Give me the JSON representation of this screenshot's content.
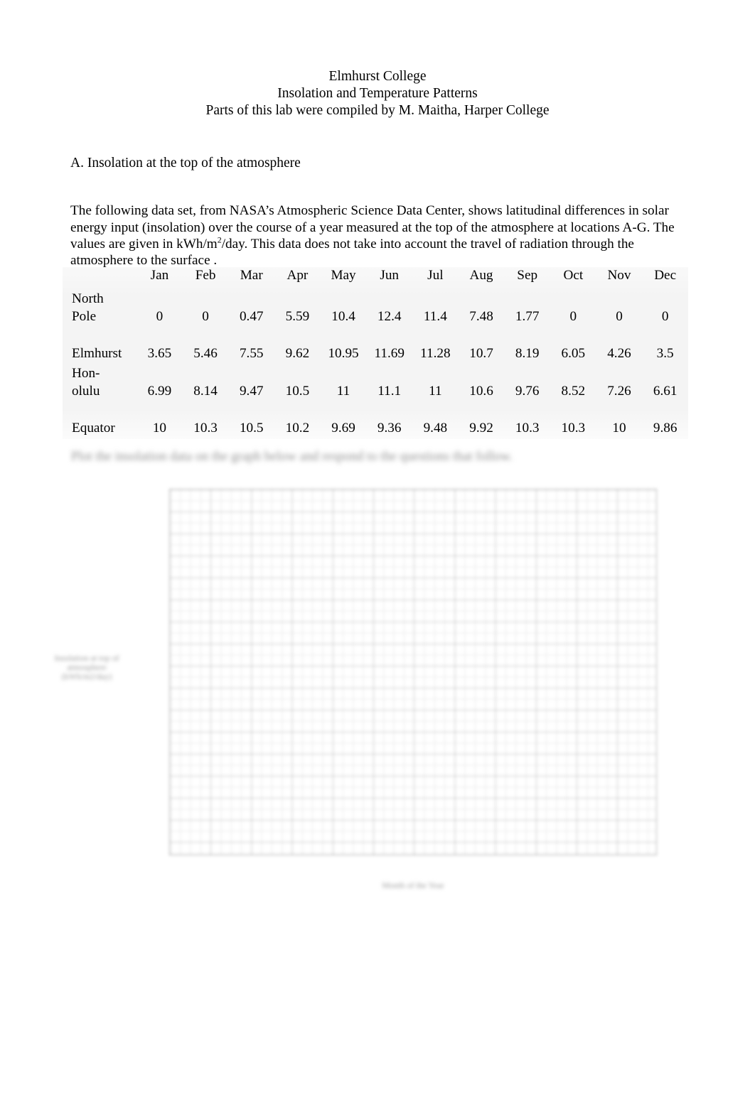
{
  "document": {
    "header": {
      "line1": "Elmhurst College",
      "line2": "Insolation and Temperature Patterns",
      "line3": "Parts of this lab were compiled by M. Maitha, Harper College"
    },
    "section_heading": "A. Insolation at the top of the atmosphere",
    "intro_paragraph": {
      "part1": "The following data set, from NASA’s Atmospheric Science Data Center, shows latitudinal differences in solar energy input (insolation) over the course of a year measured at the top of the atmosphere at locations A-G. The values are given in kWh/m",
      "superscript": "2",
      "part2": "/day. This data does not take into account the travel of radiation through the atmosphere to the surface ."
    },
    "instruction_line": "Plot the insolation data on the graph below and respond to the questions that follow.",
    "axis_label_y": "Insolation at top of atmosphere (kWh/m2/day)",
    "axis_label_x": "Month of the Year"
  },
  "chart_data": {
    "type": "table",
    "title": "Insolation at the top of the atmosphere",
    "ylabel": "Insolation at top of atmosphere (kWh/m2/day)",
    "xlabel": "Month of the Year",
    "units": "kWh/m2/day",
    "grid": true,
    "columns": [
      "",
      "Jan",
      "Feb",
      "Mar",
      "Apr",
      "May",
      "Jun",
      "Jul",
      "Aug",
      "Sep",
      "Oct",
      "Nov",
      "Dec"
    ],
    "categories": [
      "Jan",
      "Feb",
      "Mar",
      "Apr",
      "May",
      "Jun",
      "Jul",
      "Aug",
      "Sep",
      "Oct",
      "Nov",
      "Dec"
    ],
    "series": [
      {
        "name": "North Pole",
        "label_line1": "North",
        "label_line2": "Pole",
        "values": [
          0,
          0,
          0.47,
          5.59,
          10.4,
          12.4,
          11.4,
          7.48,
          1.77,
          0,
          0,
          0
        ],
        "display": [
          "0",
          "0",
          "0.47",
          "5.59",
          "10.4",
          "12.4",
          "11.4",
          "7.48",
          "1.77",
          "0",
          "0",
          "0"
        ]
      },
      {
        "name": "Elmhurst",
        "label_line1": "Elmhurst",
        "label_line2": "",
        "values": [
          3.65,
          5.46,
          7.55,
          9.62,
          10.95,
          11.69,
          11.28,
          10.7,
          8.19,
          6.05,
          4.26,
          3.5
        ],
        "display": [
          "3.65",
          "5.46",
          "7.55",
          "9.62",
          "10.95",
          "11.69",
          "11.28",
          "10.7",
          "8.19",
          "6.05",
          "4.26",
          "3.5"
        ]
      },
      {
        "name": "Honolulu",
        "label_line1": "Hon-",
        "label_line2": "olulu",
        "values": [
          6.99,
          8.14,
          9.47,
          10.5,
          11,
          11.1,
          11,
          10.6,
          9.76,
          8.52,
          7.26,
          6.61
        ],
        "display": [
          "6.99",
          "8.14",
          "9.47",
          "10.5",
          "11",
          "11.1",
          "11",
          "10.6",
          "9.76",
          "8.52",
          "7.26",
          "6.61"
        ]
      },
      {
        "name": "Equator",
        "label_line1": "Equator",
        "label_line2": "",
        "values": [
          10,
          10.3,
          10.5,
          10.2,
          9.69,
          9.36,
          9.48,
          9.92,
          10.3,
          10.3,
          10,
          9.86
        ],
        "display": [
          "10",
          "10.3",
          "10.5",
          "10.2",
          "9.69",
          "9.36",
          "9.48",
          "9.92",
          "10.3",
          "10.3",
          "10",
          "9.86"
        ]
      }
    ]
  }
}
